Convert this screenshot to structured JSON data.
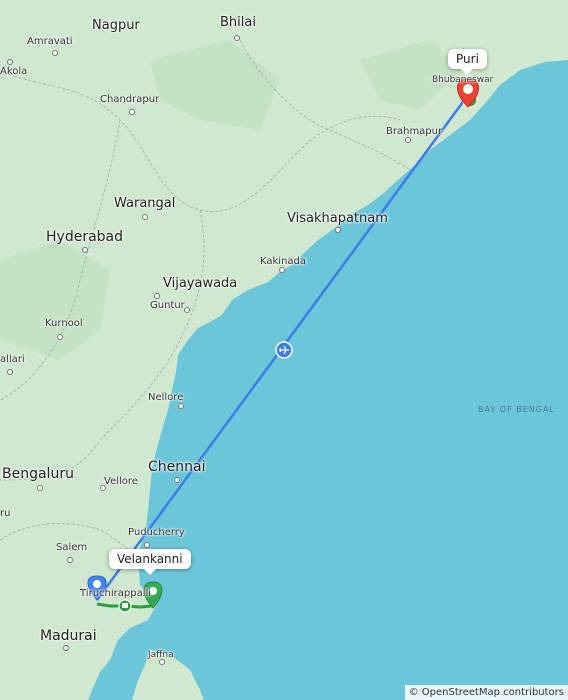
{
  "cities": {
    "nagpur": "Nagpur",
    "bhilai": "Bhilai",
    "amravati": "Amravati",
    "akola": "Akola",
    "chandrapur": "Chandrapur",
    "bhubaneswar": "Bhubaneswar",
    "brahmapur": "Brahmapur",
    "warangal": "Warangal",
    "hyderabad": "Hyderabad",
    "visakhapatnam": "Visakhapatnam",
    "kakinada": "Kakinada",
    "vijayawada": "Vijayawada",
    "guntur": "Guntur",
    "kurnool": "Kurnool",
    "ballari": "allari",
    "nellore": "Nellore",
    "chennai": "Chennai",
    "bengaluru": "Bengaluru",
    "vellore": "Vellore",
    "puducherry": "Puducherry",
    "salem": "Salem",
    "tiruchirappalli": "Tiruchirappalli",
    "madurai": "Madurai",
    "jaffna": "Jaffna",
    "partial_ru": "ru"
  },
  "sea_label": "BAY OF BENGAL",
  "markers": {
    "start": {
      "name": "Velankanni",
      "color": "#4285f4"
    },
    "mid": {
      "color": "#34a853"
    },
    "end": {
      "name": "Puri",
      "color": "#ea4335"
    }
  },
  "route": {
    "flight_color": "#3d7be8",
    "ground_color": "#2e9b3e"
  },
  "attribution": "© OpenStreetMap contributors"
}
